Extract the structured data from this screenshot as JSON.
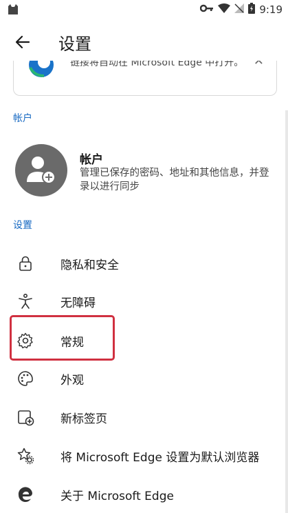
{
  "status": {
    "time": "9:19"
  },
  "header": {
    "title": "设置"
  },
  "card": {
    "text": "链接将自动在 Microsoft Edge 中打开。"
  },
  "sections": {
    "account": "帐户",
    "settings": "设置"
  },
  "account": {
    "title": "帐户",
    "description": "管理已保存的密码、地址和其他信息，并登录以进行同步"
  },
  "items": [
    {
      "label": "隐私和安全",
      "icon": "lock-icon"
    },
    {
      "label": "无障碍",
      "icon": "accessibility-icon"
    },
    {
      "label": "常规",
      "icon": "gear-icon"
    },
    {
      "label": "外观",
      "icon": "palette-icon"
    },
    {
      "label": "新标签页",
      "icon": "new-tab-icon"
    },
    {
      "label": "将 Microsoft Edge 设置为默认浏览器",
      "icon": "star-gear-icon"
    },
    {
      "label": "关于 Microsoft Edge",
      "icon": "edge-icon"
    }
  ],
  "colors": {
    "accent": "#1769c2",
    "highlight": "#d03040"
  }
}
